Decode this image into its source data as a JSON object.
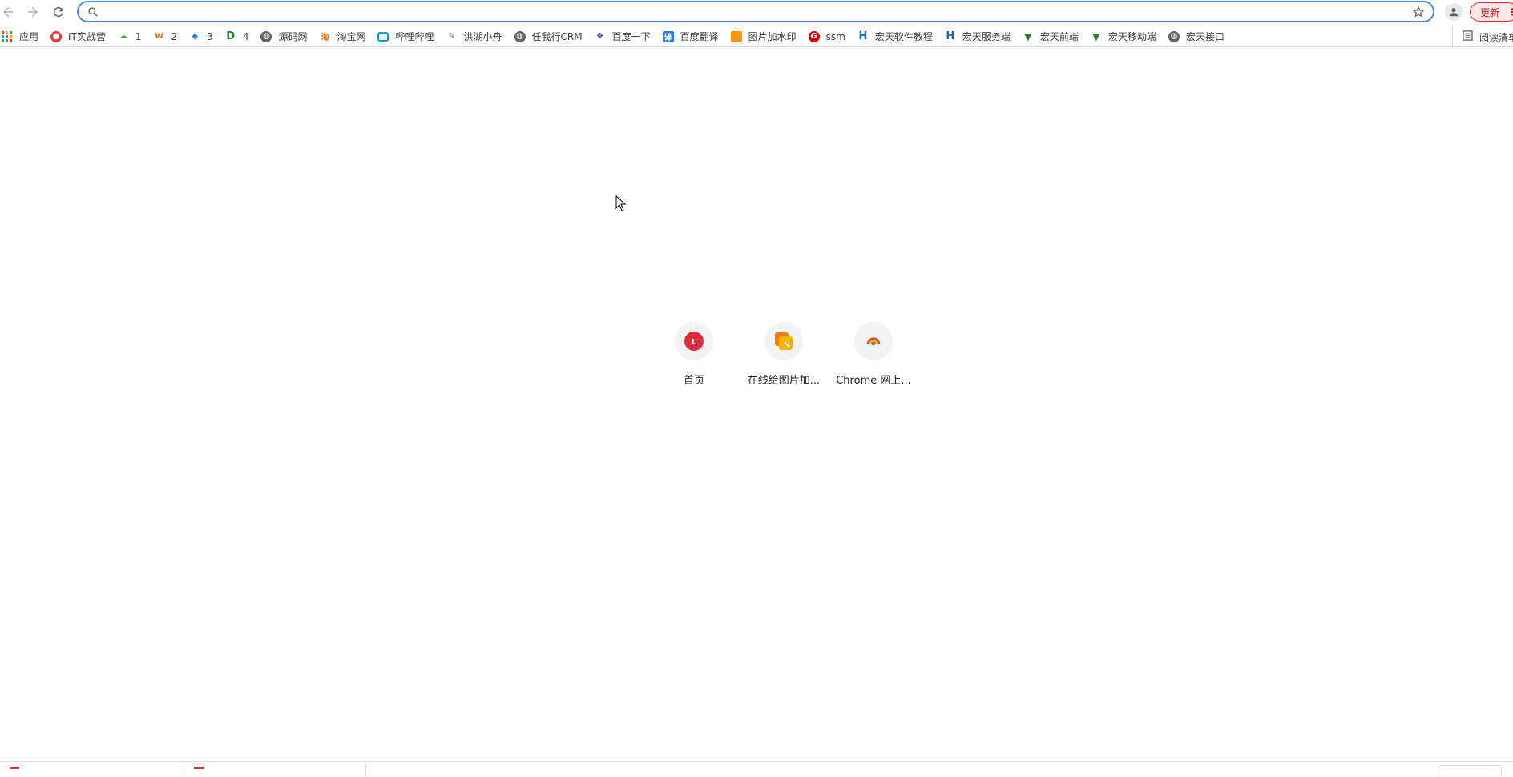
{
  "toolbar": {
    "omnibox_value": "",
    "update_label": "更新"
  },
  "bookmarks": [
    {
      "label": "应用",
      "icon": "apps-grid-icon"
    },
    {
      "label": "IT实战营",
      "icon": "red-circle-icon"
    },
    {
      "label": "1",
      "icon": "cloud-icon"
    },
    {
      "label": "2",
      "icon": "orange-w-icon"
    },
    {
      "label": "3",
      "icon": "blue-whale-icon"
    },
    {
      "label": "4",
      "icon": "green-d-icon"
    },
    {
      "label": "源码网",
      "icon": "globe-icon"
    },
    {
      "label": "淘宝网",
      "icon": "taobao-icon"
    },
    {
      "label": "哔哩哔哩",
      "icon": "bilibili-icon"
    },
    {
      "label": "洪湖小舟",
      "icon": "feather-icon"
    },
    {
      "label": "任我行CRM",
      "icon": "globe-icon"
    },
    {
      "label": "百度一下",
      "icon": "baidu-paw-icon"
    },
    {
      "label": "百度翻译",
      "icon": "translate-icon"
    },
    {
      "label": "图片加水印",
      "icon": "orange-square-icon"
    },
    {
      "label": "ssm",
      "icon": "red-g-icon"
    },
    {
      "label": "宏天软件教程",
      "icon": "blue-h-icon"
    },
    {
      "label": "宏天服务端",
      "icon": "blue-h-icon"
    },
    {
      "label": "宏天前端",
      "icon": "vue-icon"
    },
    {
      "label": "宏天移动端",
      "icon": "vue-icon"
    },
    {
      "label": "宏天接口",
      "icon": "globe-icon"
    }
  ],
  "reading_list_label": "阅读清单",
  "tiles": [
    {
      "label": "首页",
      "icon": "red-l-icon"
    },
    {
      "label": "在线给图片加...",
      "icon": "orange-square-icon"
    },
    {
      "label": "Chrome 网上...",
      "icon": "chrome-webstore-icon"
    }
  ],
  "colors": {
    "omnibox_border": "#4a86e8",
    "update_accent": "#d93025"
  }
}
